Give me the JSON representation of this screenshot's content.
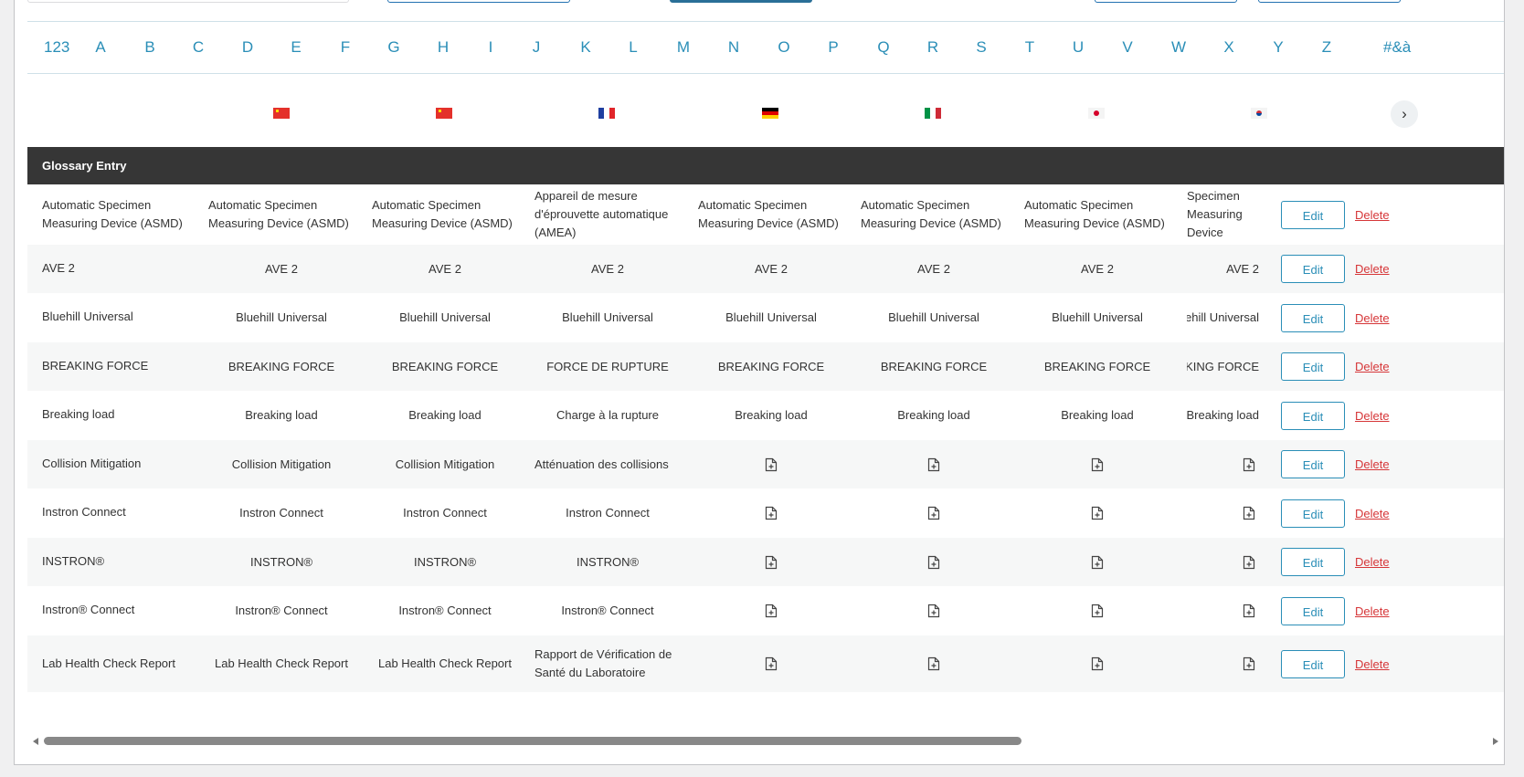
{
  "alphabet": [
    "123",
    "A",
    "B",
    "C",
    "D",
    "E",
    "F",
    "G",
    "H",
    "I",
    "J",
    "K",
    "L",
    "M",
    "N",
    "O",
    "P",
    "Q",
    "R",
    "S",
    "T",
    "U",
    "V",
    "W",
    "X",
    "Y",
    "Z",
    "#&à"
  ],
  "languages": [
    {
      "flag": "cn"
    },
    {
      "flag": "cn"
    },
    {
      "flag": "fr"
    },
    {
      "flag": "de"
    },
    {
      "flag": "it"
    },
    {
      "flag": "jp"
    },
    {
      "flag": "kr"
    }
  ],
  "next_icon": "›",
  "colors": {
    "accent": "#2a8eb7",
    "delete": "#d63638",
    "header_bg": "#363636"
  },
  "table": {
    "header": "Glossary Entry",
    "edit_label": "Edit",
    "delete_label": "Delete",
    "add_icon": "file-plus-icon",
    "rows": [
      {
        "entry": "Automatic Specimen Measuring Device (ASMD)",
        "t": [
          "Automatic Specimen Measuring Device (ASMD)",
          "Automatic Specimen Measuring Device (ASMD)",
          "Appareil de mesure d'éprouvette automatique (AMEA)",
          "Automatic Specimen Measuring Device (ASMD)",
          "Automatic Specimen Measuring Device (ASMD)",
          "Automatic Specimen Measuring Device (ASMD)",
          "Automatic Specimen Measuring Device (ASMD)"
        ]
      },
      {
        "entry": "AVE 2",
        "t": [
          "AVE 2",
          "AVE 2",
          "AVE 2",
          "AVE 2",
          "AVE 2",
          "AVE 2",
          "AVE 2"
        ]
      },
      {
        "entry": "Bluehill Universal",
        "t": [
          "Bluehill Universal",
          "Bluehill Universal",
          "Bluehill Universal",
          "Bluehill Universal",
          "Bluehill Universal",
          "Bluehill Universal",
          "Bluehill Universal"
        ]
      },
      {
        "entry": "BREAKING FORCE",
        "t": [
          "BREAKING FORCE",
          "BREAKING FORCE",
          "FORCE DE RUPTURE",
          "BREAKING FORCE",
          "BREAKING FORCE",
          "BREAKING FORCE",
          "BREAKING FORCE"
        ]
      },
      {
        "entry": "Breaking load",
        "t": [
          "Breaking load",
          "Breaking load",
          "Charge à la rupture",
          "Breaking load",
          "Breaking load",
          "Breaking load",
          "Breaking load"
        ]
      },
      {
        "entry": "Collision Mitigation",
        "t": [
          "Collision Mitigation",
          "Collision Mitigation",
          "Atténuation des collisions",
          null,
          null,
          null,
          null
        ]
      },
      {
        "entry": "Instron Connect",
        "t": [
          "Instron Connect",
          "Instron Connect",
          "Instron Connect",
          null,
          null,
          null,
          null
        ]
      },
      {
        "entry": "INSTRON®",
        "t": [
          "INSTRON®",
          "INSTRON®",
          "INSTRON®",
          null,
          null,
          null,
          null
        ]
      },
      {
        "entry": "Instron® Connect",
        "t": [
          "Instron® Connect",
          "Instron® Connect",
          "Instron® Connect",
          null,
          null,
          null,
          null
        ]
      },
      {
        "entry": "Lab Health Check Report",
        "t": [
          "Lab Health Check Report",
          "Lab Health Check Report",
          "Rapport de Vérification de Santé du Laboratoire",
          null,
          null,
          null,
          null
        ]
      }
    ]
  }
}
